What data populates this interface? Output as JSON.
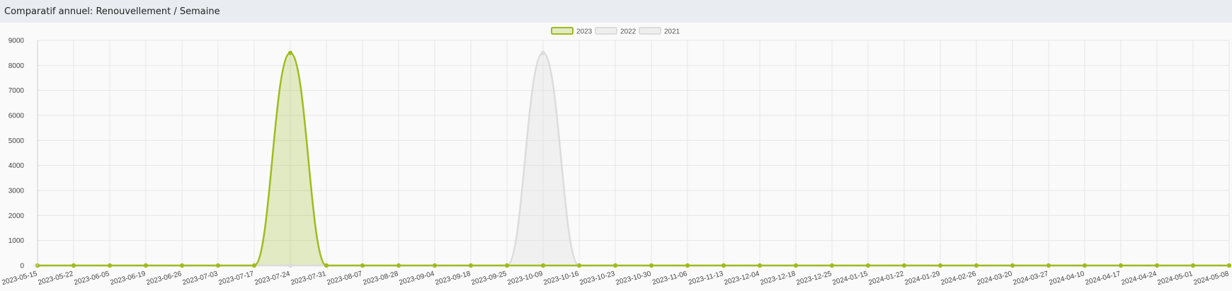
{
  "panel": {
    "title": "Comparatif annuel: Renouvellement / Semaine"
  },
  "chart_data": {
    "type": "area",
    "title": "",
    "xlabel": "",
    "ylabel": "",
    "ylim": [
      0,
      9000
    ],
    "yticks": [
      0,
      1000,
      2000,
      3000,
      4000,
      5000,
      6000,
      7000,
      8000,
      9000
    ],
    "grid": true,
    "legend_position": "top-center",
    "categories": [
      "2023-05-15",
      "2023-05-22",
      "2023-06-05",
      "2023-06-19",
      "2023-06-26",
      "2023-07-03",
      "2023-07-17",
      "2023-07-24",
      "2023-07-31",
      "2023-08-07",
      "2023-08-28",
      "2023-09-04",
      "2023-09-18",
      "2023-09-25",
      "2023-10-09",
      "2023-10-16",
      "2023-10-23",
      "2023-10-30",
      "2023-11-06",
      "2023-11-13",
      "2023-12-04",
      "2023-12-18",
      "2023-12-25",
      "2024-01-15",
      "2024-01-22",
      "2024-01-29",
      "2024-02-26",
      "2024-03-20",
      "2024-03-27",
      "2024-04-10",
      "2024-04-17",
      "2024-04-24",
      "2024-05-01",
      "2024-05-08"
    ],
    "series": [
      {
        "name": "2023",
        "color": "#9dbc1e",
        "fill": "rgba(157,188,30,0.25)",
        "values": [
          0,
          0,
          0,
          0,
          0,
          0,
          0,
          8500,
          0,
          0,
          0,
          0,
          0,
          0,
          0,
          0,
          0,
          0,
          0,
          0,
          0,
          0,
          0,
          0,
          0,
          0,
          0,
          0,
          0,
          0,
          0,
          0,
          0,
          0
        ]
      },
      {
        "name": "2022",
        "color": "#dcdcdc",
        "fill": "rgba(220,220,220,0.35)",
        "values": [
          0,
          0,
          0,
          0,
          0,
          0,
          0,
          0,
          0,
          0,
          0,
          0,
          0,
          0,
          8500,
          0,
          0,
          0,
          0,
          0,
          0,
          0,
          0,
          0,
          0,
          0,
          0,
          0,
          0,
          0,
          0,
          0,
          0,
          0
        ]
      },
      {
        "name": "2021",
        "color": "#dcdcdc",
        "fill": "rgba(220,220,220,0.35)",
        "values": []
      }
    ]
  }
}
